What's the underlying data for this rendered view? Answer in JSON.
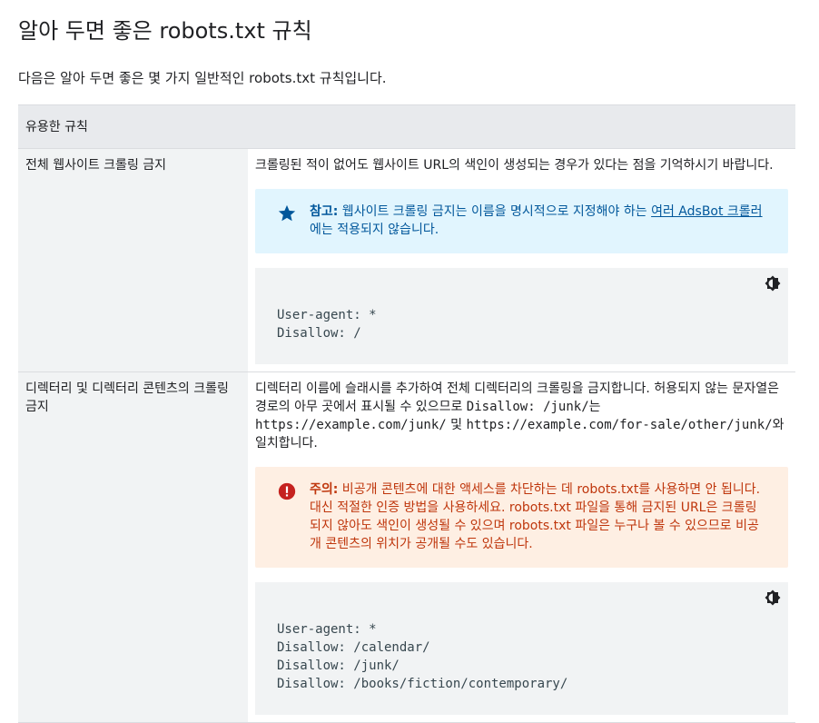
{
  "title": "알아 두면 좋은 robots.txt 규칙",
  "intro": "다음은 알아 두면 좋은 몇 가지 일반적인 robots.txt 규칙입니다.",
  "table": {
    "header": "유용한 규칙",
    "rows": [
      {
        "rule": "전체 웹사이트 크롤링 금지",
        "desc": "크롤링된 적이 없어도 웹사이트 URL의 색인이 생성되는 경우가 있다는 점을 기억하시기 바랍니다.",
        "note_label": "참고:",
        "note_text_a": " 웹사이트 크롤링 금지는 이름을 명시적으로 지정해야 하는 ",
        "note_link": "여러 AdsBot 크롤러",
        "note_text_b": "에는 적용되지 않습니다.",
        "code": "User-agent: *\nDisallow: /"
      },
      {
        "rule": "디렉터리 및 디렉터리 콘텐츠의 크롤링 금지",
        "desc_a": "디렉터리 이름에 슬래시를 추가하여 전체 디렉터리의 크롤링을 금지합니다. 허용되지 않는 문자열은 경로의 아무 곳에서 표시될 수 있으므로 ",
        "desc_code1": "Disallow: /junk/",
        "desc_b": "는 ",
        "desc_code2": "https://example.com/junk/",
        "desc_c": " 및 ",
        "desc_code3": "https://example.com/for-sale/other/junk/",
        "desc_d": "와 일치합니다.",
        "caution_label": "주의:",
        "caution_text": " 비공개 콘텐츠에 대한 액세스를 차단하는 데 robots.txt를 사용하면 안 됩니다. 대신 적절한 인증 방법을 사용하세요. robots.txt 파일을 통해 금지된 URL은 크롤링되지 않아도 색인이 생성될 수 있으며 robots.txt 파일은 누구나 볼 수 있으므로 비공개 콘텐츠의 위치가 공개될 수도 있습니다.",
        "code": "User-agent: *\nDisallow: /calendar/\nDisallow: /junk/\nDisallow: /books/fiction/contemporary/"
      }
    ]
  },
  "icons": {
    "note": "star-icon",
    "caution": "exclamation-circle-icon",
    "theme": "theme-toggle-icon"
  },
  "colors": {
    "note_bg": "#e1f5fe",
    "note_fg": "#01579b",
    "caution_bg": "#feefe3",
    "caution_fg": "#bf360c",
    "header_bg": "#e8eaed",
    "code_bg": "#f1f3f4"
  }
}
